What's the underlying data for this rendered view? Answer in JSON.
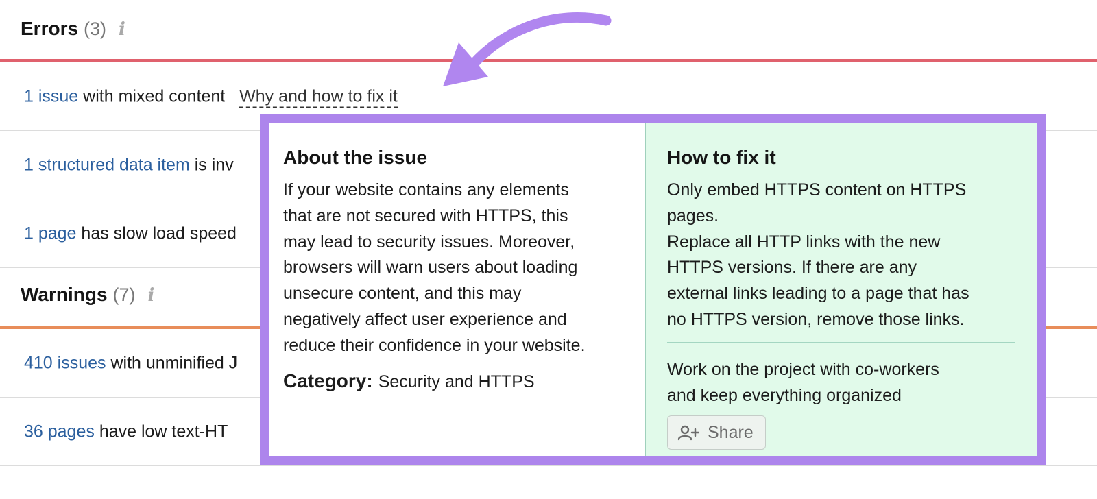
{
  "errors_section": {
    "title": "Errors",
    "count": "(3)",
    "info_icon": "i"
  },
  "error_rows": [
    {
      "link": "1 issue",
      "text": " with mixed content",
      "why_link": "Why and how to fix it"
    },
    {
      "link": "1 structured data item",
      "text": " is inv"
    },
    {
      "link": "1 page",
      "text": " has slow load speed"
    }
  ],
  "warnings_section": {
    "title": "Warnings",
    "count": "(7)",
    "info_icon": "i"
  },
  "warning_rows": [
    {
      "link": "410 issues",
      "text": " with unminified J"
    },
    {
      "link": "36 pages",
      "text": " have low text-HT"
    }
  ],
  "popover": {
    "about_heading": "About the issue",
    "about_body": "If your website contains any elements\nthat are not secured with HTTPS, this\nmay lead to security issues. Moreover,\nbrowsers will warn users about loading\nunsecure content, and this may\nnegatively affect user experience and\nreduce their confidence in your website.",
    "category_label": "Category:",
    "category_value": "Security and HTTPS",
    "fix_heading": "How to fix it",
    "fix_body": "Only embed HTTPS content on HTTPS\npages.\nReplace all HTTP links with the new\nHTTPS versions. If there are any\nexternal links leading to a page that has\nno HTTPS version, remove those links.",
    "collab_text": "Work on the project with co-workers\nand keep everything organized",
    "share_label": "Share",
    "share_icon": "add-user-icon"
  },
  "colors": {
    "errors_rule": "#e0616d",
    "warnings_rule": "#e88d5a",
    "link": "#2b5f9e",
    "popover_border": "#ad85ec",
    "fix_panel_bg": "#e1faea",
    "annotation_arrow": "#b086ef"
  }
}
